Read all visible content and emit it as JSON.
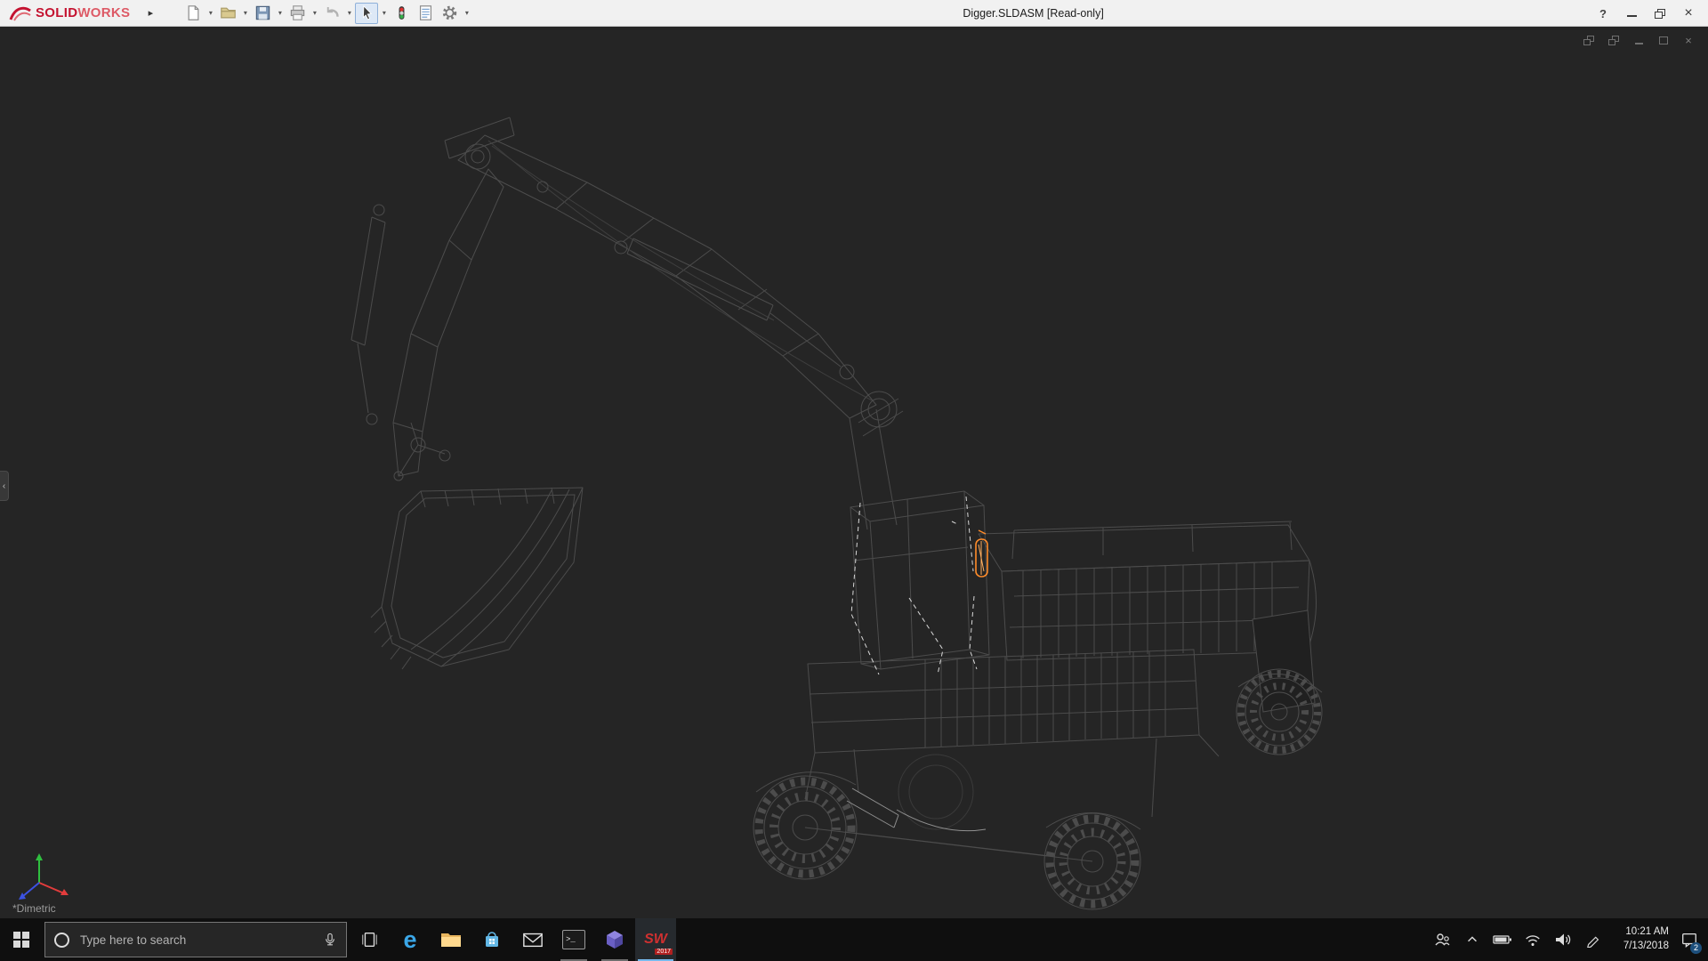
{
  "titlebar": {
    "brand_solid": "SOLID",
    "brand_works": "WORKS",
    "document_title": "Digger.SLDASM [Read-only]",
    "help_label": "?"
  },
  "icons": {
    "flyout_arrow": "▸",
    "dropdown_caret": "▾",
    "left_panel_arrow": "‹",
    "close_glyph": "×"
  },
  "viewport": {
    "orientation_label": "*Dimetric"
  },
  "taskbar": {
    "search_placeholder": "Type here to search",
    "apps": [
      {
        "name": "edge",
        "glyph": "e"
      },
      {
        "name": "command-prompt",
        "glyph": "&gt;_"
      },
      {
        "name": "solidworks",
        "glyph": "SW",
        "year": "2017"
      }
    ],
    "clock": {
      "time": "10:21 AM",
      "date": "7/13/2018"
    },
    "notification_badge": "2"
  },
  "colors": {
    "highlight_orange": "#ff8c2a",
    "brand_red": "#c41230",
    "viewport_bg": "#252525",
    "taskbar_bg": "#0f0f0f"
  }
}
